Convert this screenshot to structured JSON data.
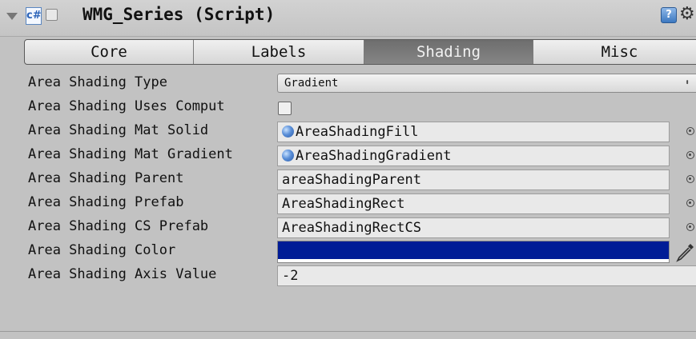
{
  "header": {
    "title": "WMG_Series (Script)",
    "icons": [
      "foldout-arrow-icon",
      "script-icon",
      "help-icon",
      "gear-icon"
    ]
  },
  "tabs": [
    {
      "label": "Core",
      "active": false
    },
    {
      "label": "Labels",
      "active": false
    },
    {
      "label": "Shading",
      "active": true
    },
    {
      "label": "Misc",
      "active": false
    }
  ],
  "properties": {
    "area_shading_type": {
      "label": "Area Shading Type",
      "value": "Gradient"
    },
    "area_shading_uses_compute": {
      "label": "Area Shading Uses Comput",
      "checked": false
    },
    "area_shading_mat_solid": {
      "label": "Area Shading Mat Solid",
      "value": "AreaShadingFill"
    },
    "area_shading_mat_gradient": {
      "label": "Area Shading Mat Gradient",
      "value": "AreaShadingGradient"
    },
    "area_shading_parent": {
      "label": "Area Shading Parent",
      "value": "areaShadingParent"
    },
    "area_shading_prefab": {
      "label": "Area Shading Prefab",
      "value": "AreaShadingRect"
    },
    "area_shading_cs_prefab": {
      "label": "Area Shading CS Prefab",
      "value": "AreaShadingRectCS"
    },
    "area_shading_color": {
      "label": "Area Shading Color",
      "color": "#001c96"
    },
    "area_shading_axis_value": {
      "label": "Area Shading Axis Value",
      "value": "-2"
    }
  },
  "colors": {
    "panel_bg": "#c2c2c2",
    "active_tab": "#7a7a7a",
    "shading_color": "#001c96"
  }
}
